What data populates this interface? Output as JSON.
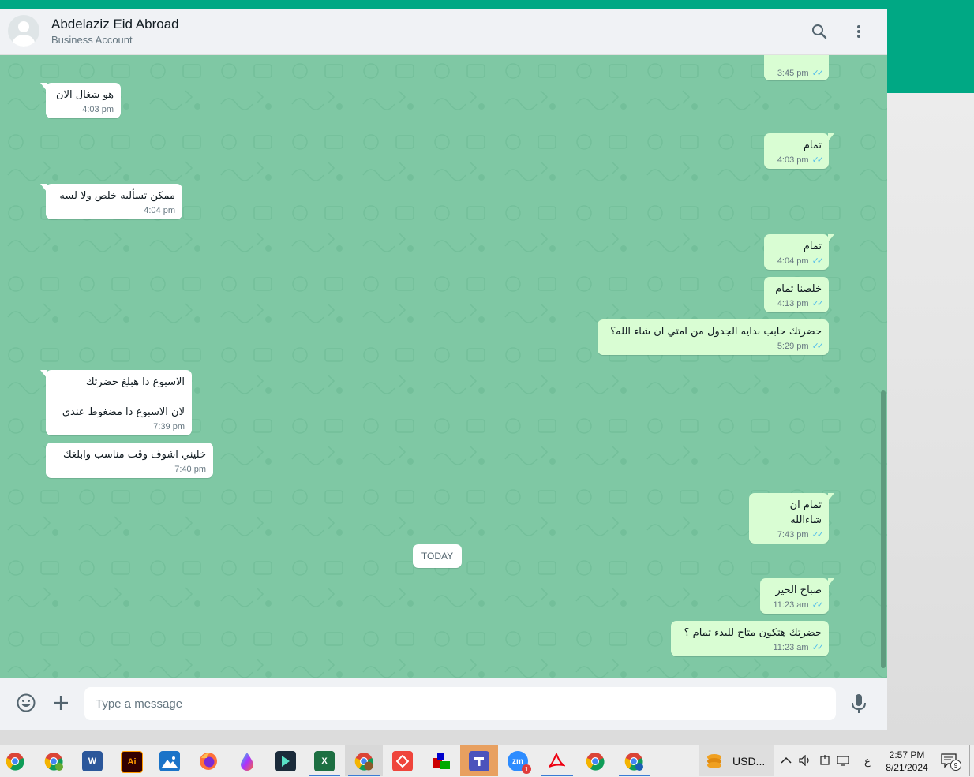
{
  "header": {
    "contact_name": "Abdelaziz Eid Abroad",
    "contact_subtitle": "Business Account",
    "search_icon": "search-icon",
    "menu_icon": "more-vertical-icon"
  },
  "colors": {
    "accent": "#00a884",
    "chat_bg": "#7fc8a4",
    "incoming_bubble": "#ffffff",
    "outgoing_bubble": "#d9fdd3",
    "read_ticks": "#53bdeb"
  },
  "messages": [
    {
      "dir": "out",
      "text": "",
      "time": "3:45 pm",
      "read": true
    },
    {
      "dir": "in",
      "text": "هو شغال الان",
      "time": "4:03 pm"
    },
    {
      "dir": "out",
      "text": "تمام",
      "time": "4:03 pm",
      "read": true
    },
    {
      "dir": "in",
      "text": "ممكن تسأليه خلص ولا لسه",
      "time": "4:04 pm"
    },
    {
      "dir": "out",
      "text": "تمام",
      "time": "4:04 pm",
      "read": true
    },
    {
      "dir": "out",
      "text": "خلصنا تمام",
      "time": "4:13 pm",
      "read": true
    },
    {
      "dir": "out",
      "text": "حضرتك حابب بدايه الجدول من امتي ان شاء الله؟",
      "time": "5:29 pm",
      "read": true
    },
    {
      "dir": "in",
      "text": "الاسبوع دا هبلغ حضرتك\n\nلان الاسبوع دا مضغوط عندي",
      "time": "7:39 pm"
    },
    {
      "dir": "in",
      "text": "خليني اشوف وقت مناسب وابلغك",
      "time": "7:40 pm"
    },
    {
      "dir": "out",
      "text": "تمام ان شاءالله",
      "time": "7:43 pm",
      "read": true
    },
    {
      "dir": "out",
      "text": "صباح الخير",
      "time": "11:23 am",
      "read": true
    },
    {
      "dir": "out",
      "text": "حضرتك هتكون متاح للبدء تمام ؟",
      "time": "11:23 am",
      "read": true
    }
  ],
  "date_divider": "TODAY",
  "composer": {
    "placeholder": "Type a message",
    "emoji_icon": "emoji-icon",
    "attach_icon": "plus-icon",
    "mic_icon": "mic-icon"
  },
  "taskbar": {
    "apps": [
      "chrome-icon",
      "chrome-profile-icon",
      "word-icon",
      "illustrator-icon",
      "photos-icon",
      "firefox-icon",
      "paint-drop-icon",
      "filmora-icon",
      "excel-icon",
      "chrome-active-icon",
      "anydesk-icon",
      "app-icon",
      "teams-icon",
      "zoom-icon",
      "acrobat-icon",
      "chrome-icon-2",
      "chrome-profile-icon-2"
    ],
    "word_label": "W",
    "illustrator_label": "Ai",
    "excel_label": "X",
    "zoom_label": "zm",
    "zoom_badge": "1",
    "currency_label": "USD...",
    "lang_indicator": "ع",
    "time": "2:57 PM",
    "date": "8/21/2024",
    "notification_count": "9"
  }
}
